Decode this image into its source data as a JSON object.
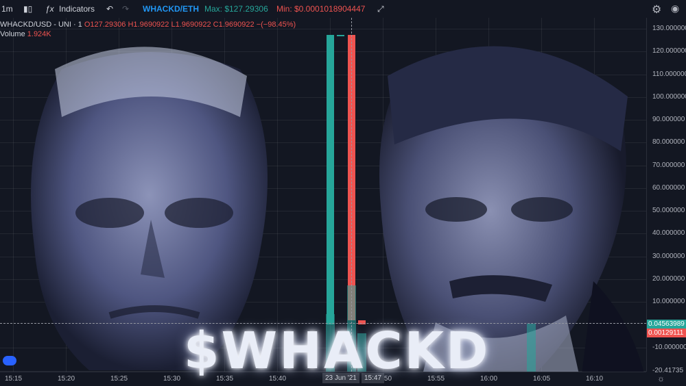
{
  "toolbar": {
    "interval": "1m",
    "indicators_label": "Indicators",
    "pair_label": "WHACKD/ETH",
    "max_label": "Max: $127.29306",
    "min_label": "Min: $0.0001018904447"
  },
  "legend": {
    "symbol": "WHACKD/USD - UNI · 1",
    "open": "O127.29306",
    "high": "H1.9690922",
    "low": "L1.9690922",
    "close": "C1.9690922",
    "change": "−(−98.45%)",
    "volume_label": "Volume",
    "volume_value": "1.924K"
  },
  "watermark": "$WHACKD",
  "y_axis": {
    "labels": [
      "130.000000",
      "120.000000",
      "110.000000",
      "100.000000",
      "90.000000",
      "80.000000",
      "70.000000",
      "60.000000",
      "50.000000",
      "40.000000",
      "30.000000",
      "20.000000",
      "10.000000",
      "-10.000000",
      "-20.41735"
    ],
    "tag_green": "0.04563989",
    "tag_red": "0.00129111"
  },
  "x_axis": {
    "labels": [
      "15:15",
      "15:20",
      "15:25",
      "15:30",
      "15:35",
      "15:40",
      "15:50",
      "15:55",
      "16:00",
      "16:05",
      "16:10"
    ],
    "date_tag": "23 Jun '21",
    "time_tag": "15:47"
  },
  "chart_data": {
    "type": "bar",
    "ylim": [
      -20.41735,
      133
    ],
    "candles": [
      {
        "time": "15:45",
        "open": 0.05,
        "close": 127.29306,
        "color": "#26a69a"
      },
      {
        "time": "15:46",
        "open": 127.29306,
        "close": 127.0,
        "color": "#26a69a"
      },
      {
        "time": "15:47",
        "open": 127.29306,
        "close": 1.9690922,
        "color": "#ef5350"
      },
      {
        "time": "15:48",
        "open": 1.9690922,
        "close": 0.0,
        "color": "#ef5350"
      }
    ],
    "volume": [
      {
        "time": "15:45",
        "value": 12,
        "color": "#26a69a"
      },
      {
        "time": "15:47",
        "value": 18,
        "color": "#26a69a"
      },
      {
        "time": "15:48",
        "value": 8,
        "color": "#26a69a"
      },
      {
        "time": "16:04",
        "value": 10,
        "color": "#26a69a"
      }
    ]
  },
  "colors": {
    "up": "#26a69a",
    "down": "#ef5350",
    "background": "#131722"
  },
  "icons": [
    "candles-icon",
    "fx-icon",
    "undo-icon",
    "redo-icon",
    "fullscreen-icon",
    "gear-icon",
    "camera-icon",
    "cloud-icon"
  ]
}
